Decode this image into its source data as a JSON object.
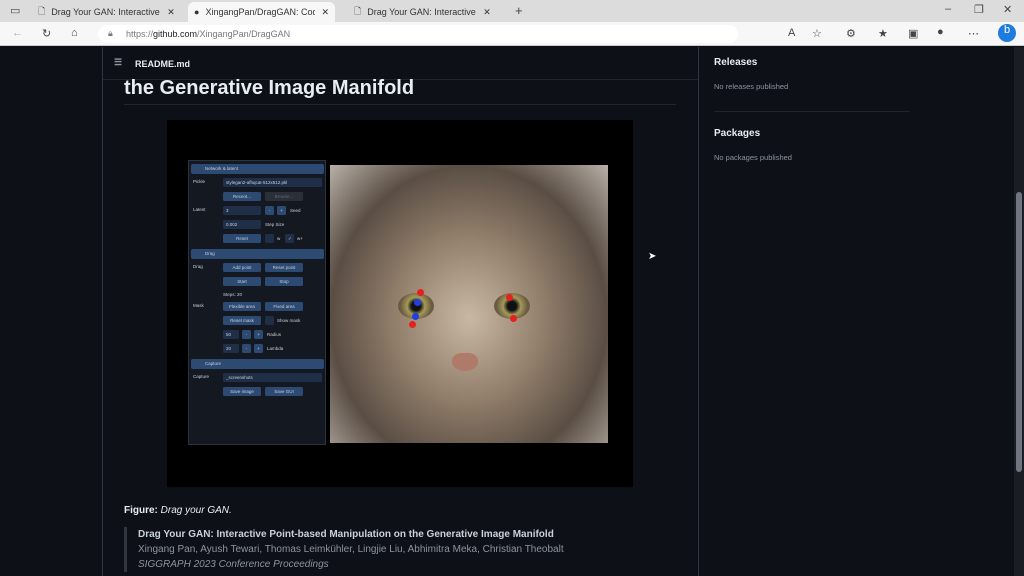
{
  "browser": {
    "tabs": [
      {
        "title": "Drag Your GAN: Interactive Point-based"
      },
      {
        "title": "XingangPan/DragGAN: Code for"
      },
      {
        "title": "Drag Your GAN: Interactive Point-based"
      }
    ],
    "url_prefix": "https://",
    "url_domain": "github.com",
    "url_path": "/XingangPan/DragGAN"
  },
  "readme": {
    "file": "README.md",
    "heading": "the Generative Image Manifold",
    "gui": {
      "sections": [
        "Network & latent",
        "Drag",
        "Capture"
      ],
      "pickle_label": "Pickle",
      "pickle_value": "stylegan2-afhqcat-512x512.pkl",
      "recent": "Recent...",
      "browse": "Browse...",
      "latent_label": "Latent",
      "seed_value": "3",
      "seed_label": "Seed",
      "step_value": "0.002",
      "step_label": "Step Size",
      "reset": "Reset",
      "w_label": "w",
      "wplus_label": "w+",
      "drag_label": "Drag",
      "add_point": "Add point",
      "reset_point": "Reset point",
      "start": "Start",
      "stop": "Stop",
      "steps": "Steps: 20",
      "mask_label": "Mask",
      "flexible": "Flexible area",
      "fixed": "Fixed area",
      "reset_mask": "Reset mask",
      "show_mask": "Show mask",
      "radius_value": "50",
      "radius_label": "Radius",
      "lambda_value": "20",
      "lambda_label": "Lambda",
      "minus": "-",
      "plus": "+",
      "capture_label": "Capture",
      "capture_value": "_screenshots",
      "save_image": "Save image",
      "save_gui": "Save GUI"
    },
    "caption_bold": "Figure:",
    "caption_italic": "Drag your GAN.",
    "quote": {
      "title": "Drag Your GAN: Interactive Point-based Manipulation on the Generative Image Manifold",
      "authors": "Xingang Pan, Ayush Tewari, Thomas Leimkühler, Lingjie Liu, Abhimitra Meka, Christian Theobalt",
      "venue": "SIGGRAPH 2023 Conference Proceedings"
    }
  },
  "sidebar": {
    "releases": "Releases",
    "releases_empty": "No releases published",
    "packages": "Packages",
    "packages_empty": "No packages published"
  }
}
